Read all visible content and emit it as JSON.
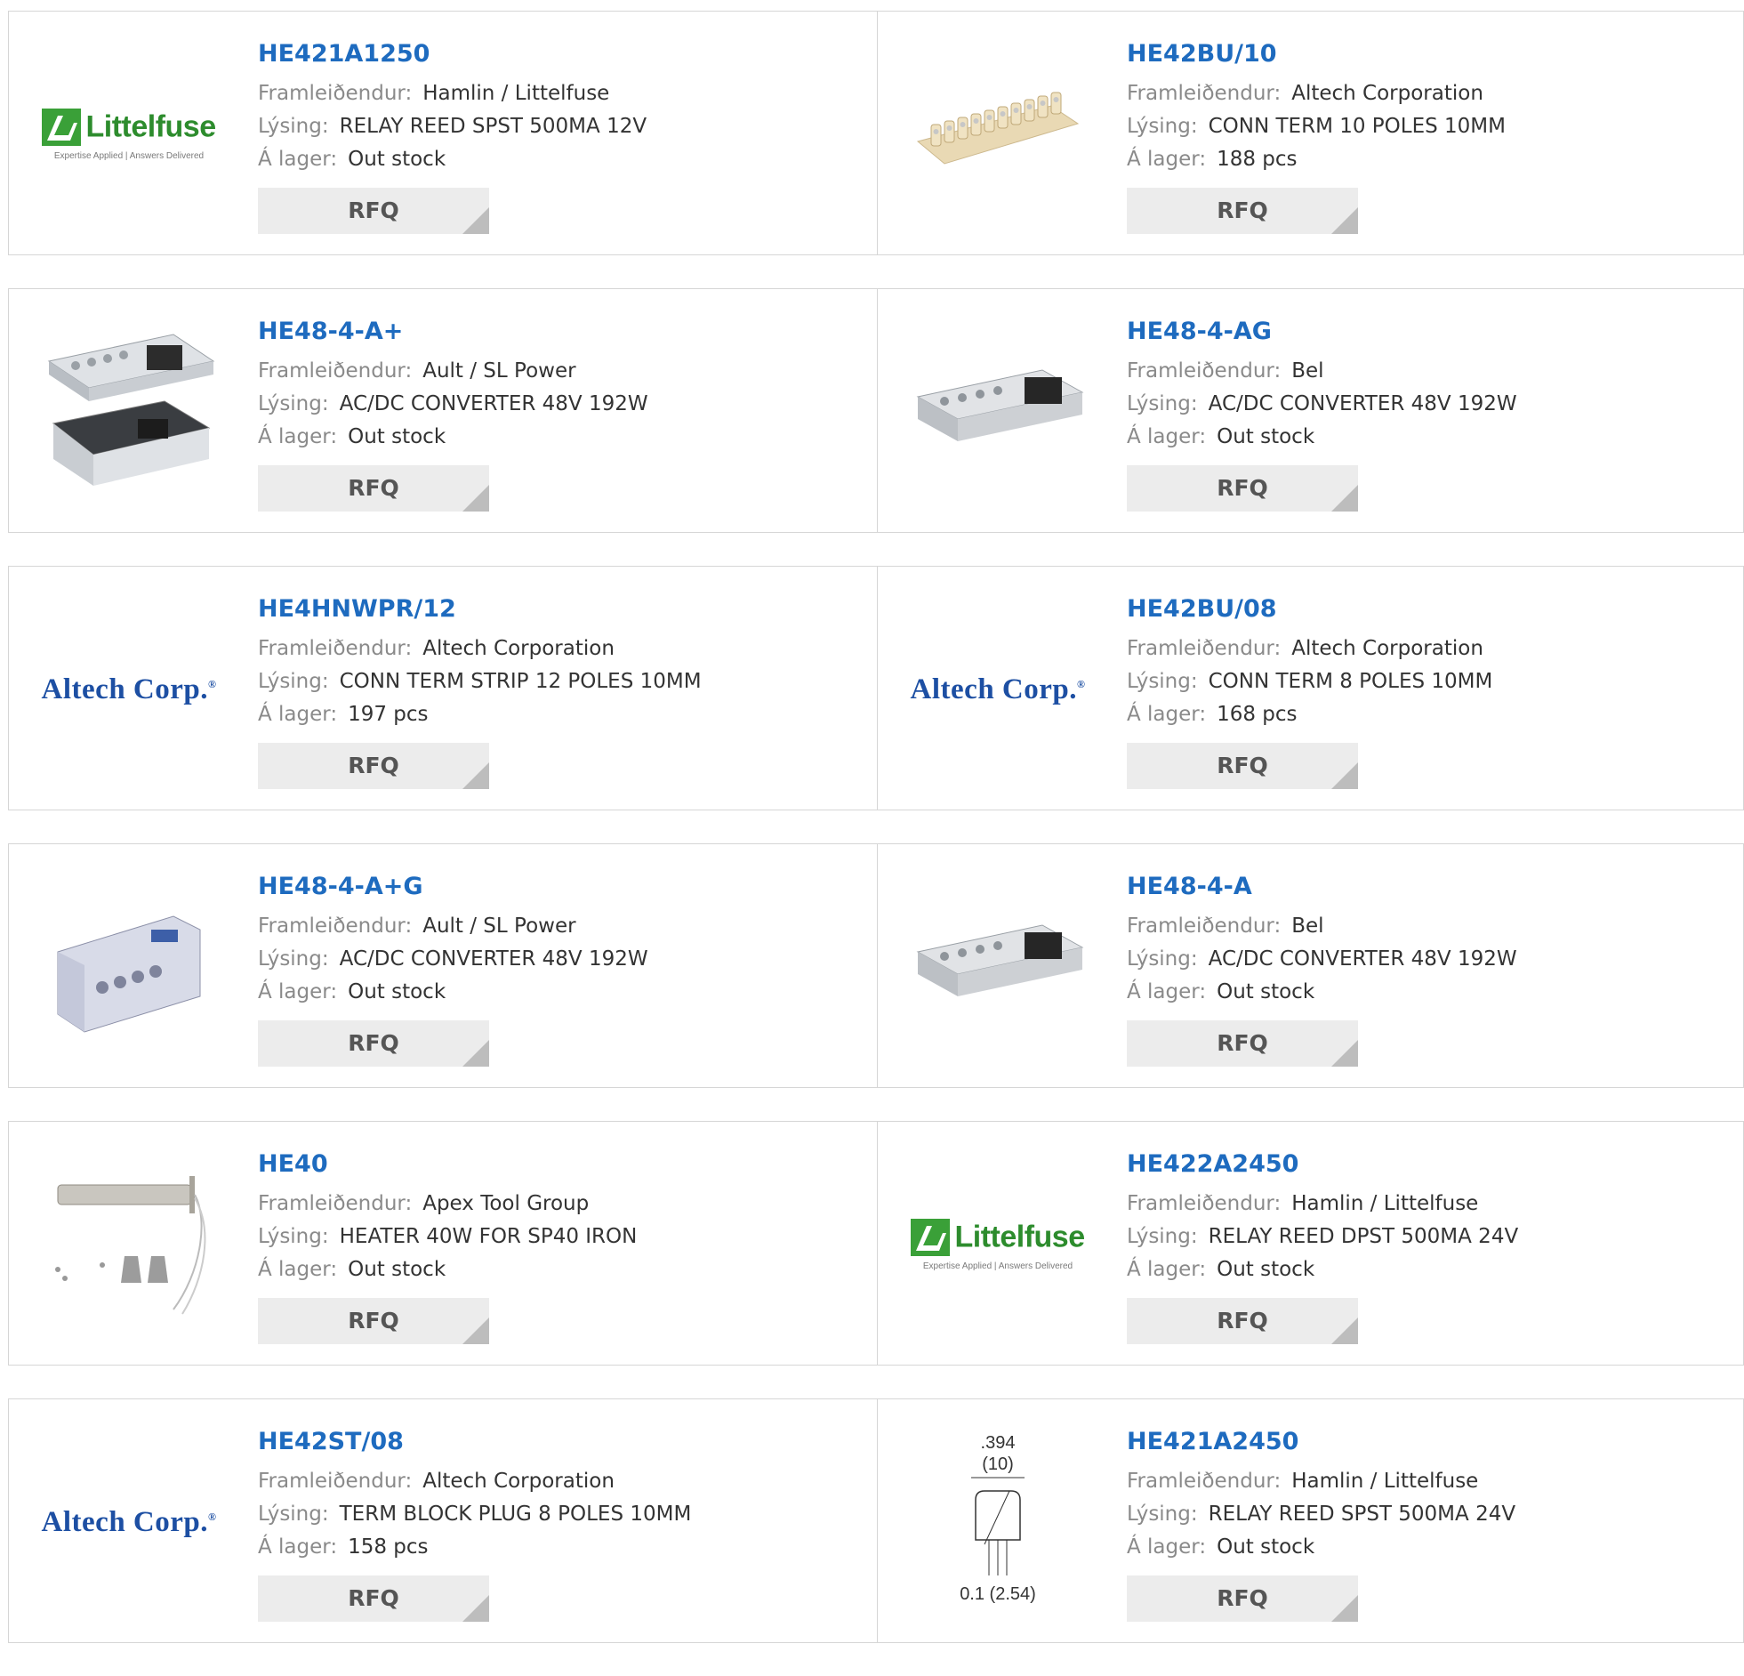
{
  "labels": {
    "manufacturer": "Framleiðendur:",
    "description": "Lýsing:",
    "stock": "Á lager:",
    "rfq": "RFQ"
  },
  "brand": {
    "littelfuse_word": "Littelfuse",
    "littelfuse_tagline": "Expertise Applied | Answers Delivered",
    "altech_word": "Altech Corp."
  },
  "colors": {
    "part_number": "#1e6bbf",
    "label": "#8a8a8a",
    "value": "#333333",
    "rfq_bg": "#ececec",
    "littelfuse_green": "#2d8c2d",
    "altech_blue": "#1d4fa3"
  },
  "products": [
    {
      "part": "HE421A1250",
      "manufacturer": "Hamlin / Littelfuse",
      "description": "RELAY REED SPST 500MA 12V",
      "stock": "Out stock",
      "image": "littelfuse-logo"
    },
    {
      "part": "HE42BU/10",
      "manufacturer": "Altech Corporation",
      "description": "CONN TERM 10 POLES 10MM",
      "stock": "188 pcs",
      "image": "terminal-strip-photo"
    },
    {
      "part": "HE48-4-A+",
      "manufacturer": "Ault / SL Power",
      "description": "AC/DC CONVERTER 48V 192W",
      "stock": "Out stock",
      "image": "power-supply-open-photo"
    },
    {
      "part": "HE48-4-AG",
      "manufacturer": "Bel",
      "description": "AC/DC CONVERTER 48V 192W",
      "stock": "Out stock",
      "image": "power-supply-photo"
    },
    {
      "part": "HE4HNWPR/12",
      "manufacturer": "Altech Corporation",
      "description": "CONN TERM STRIP 12 POLES 10MM",
      "stock": "197 pcs",
      "image": "altech-logo"
    },
    {
      "part": "HE42BU/08",
      "manufacturer": "Altech Corporation",
      "description": "CONN TERM 8 POLES 10MM",
      "stock": "168 pcs",
      "image": "altech-logo"
    },
    {
      "part": "HE48-4-A+G",
      "manufacturer": "Ault / SL Power",
      "description": "AC/DC CONVERTER 48V 192W",
      "stock": "Out stock",
      "image": "power-supply-bracket-photo"
    },
    {
      "part": "HE48-4-A",
      "manufacturer": "Bel",
      "description": "AC/DC CONVERTER 48V 192W",
      "stock": "Out stock",
      "image": "power-supply-photo"
    },
    {
      "part": "HE40",
      "manufacturer": "Apex Tool Group",
      "description": "HEATER 40W FOR SP40 IRON",
      "stock": "Out stock",
      "image": "heater-element-photo"
    },
    {
      "part": "HE422A2450",
      "manufacturer": "Hamlin / Littelfuse",
      "description": "RELAY REED DPST 500MA 24V",
      "stock": "Out stock",
      "image": "littelfuse-logo"
    },
    {
      "part": "HE42ST/08",
      "manufacturer": "Altech Corporation",
      "description": "TERM BLOCK PLUG 8 POLES 10MM",
      "stock": "158 pcs",
      "image": "altech-logo"
    },
    {
      "part": "HE421A2450",
      "manufacturer": "Hamlin / Littelfuse",
      "description": "RELAY REED SPST 500MA 24V",
      "stock": "Out stock",
      "image": "relay-dimension-drawing",
      "drawing_top": ".394",
      "drawing_top_sub": "(10)",
      "drawing_bottom": "0.1 (2.54)"
    }
  ]
}
